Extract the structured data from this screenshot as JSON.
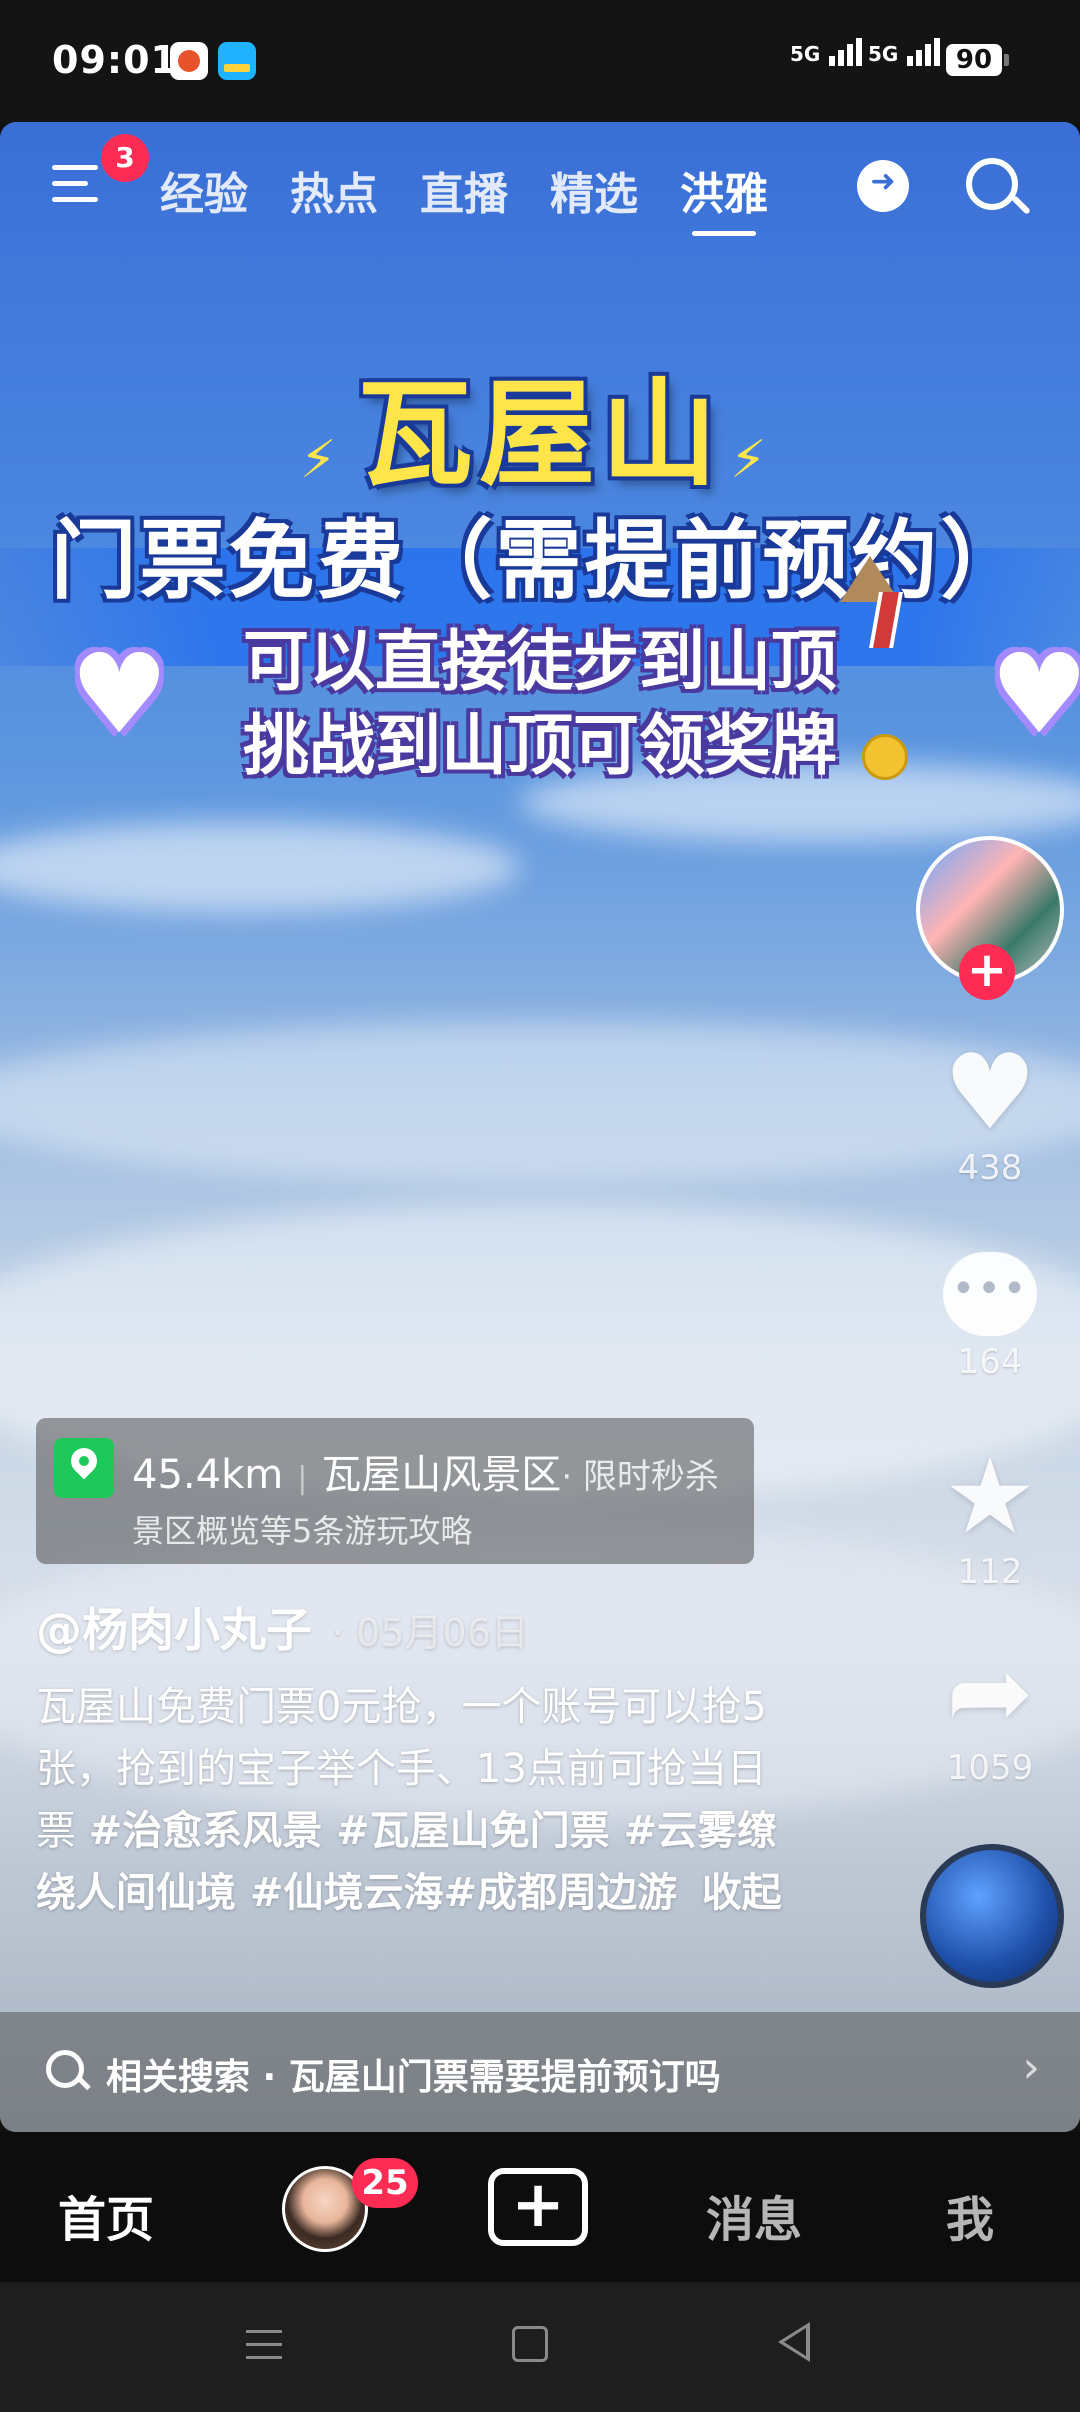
{
  "status": {
    "time": "09:01",
    "signal1": "5G",
    "signal2": "5G",
    "battery": "90"
  },
  "top_nav": {
    "menu_badge": "3",
    "tabs": [
      {
        "label": "经验"
      },
      {
        "label": "热点"
      },
      {
        "label": "直播"
      },
      {
        "label": "精选"
      },
      {
        "label": "洪雅"
      }
    ],
    "active_tab": "洪雅"
  },
  "overlay": {
    "title": "瓦屋山",
    "subtitle": "门票免费（需提前预约）",
    "line1": "可以直接徒步到山顶",
    "line2": "挑战到山顶可领奖牌"
  },
  "rail": {
    "like_count": "438",
    "comment_count": "164",
    "favorite_count": "112",
    "share_count": "1059"
  },
  "location": {
    "distance": "45.4km",
    "place": "瓦屋山风景区",
    "tag": "· 限时秒杀",
    "guide": "景区概览等5条游玩攻略"
  },
  "post": {
    "author": "@杨肉小丸子",
    "date": "· 05月06日",
    "caption_text": "瓦屋山免费门票0元抢，一个账号可以抢5张，抢到的宝子举个手、13点前可抢当日票 ",
    "hashtags": "#治愈系风景 #瓦屋山免门票 #云雾缭绕人间仙境 #仙境云海#成都周边游",
    "collapse": "收起"
  },
  "related_search": {
    "text": "相关搜索 · 瓦屋山门票需要提前预订吗"
  },
  "bottom_nav": {
    "home": "首页",
    "avatar_badge": "25",
    "messages": "消息",
    "me": "我"
  }
}
